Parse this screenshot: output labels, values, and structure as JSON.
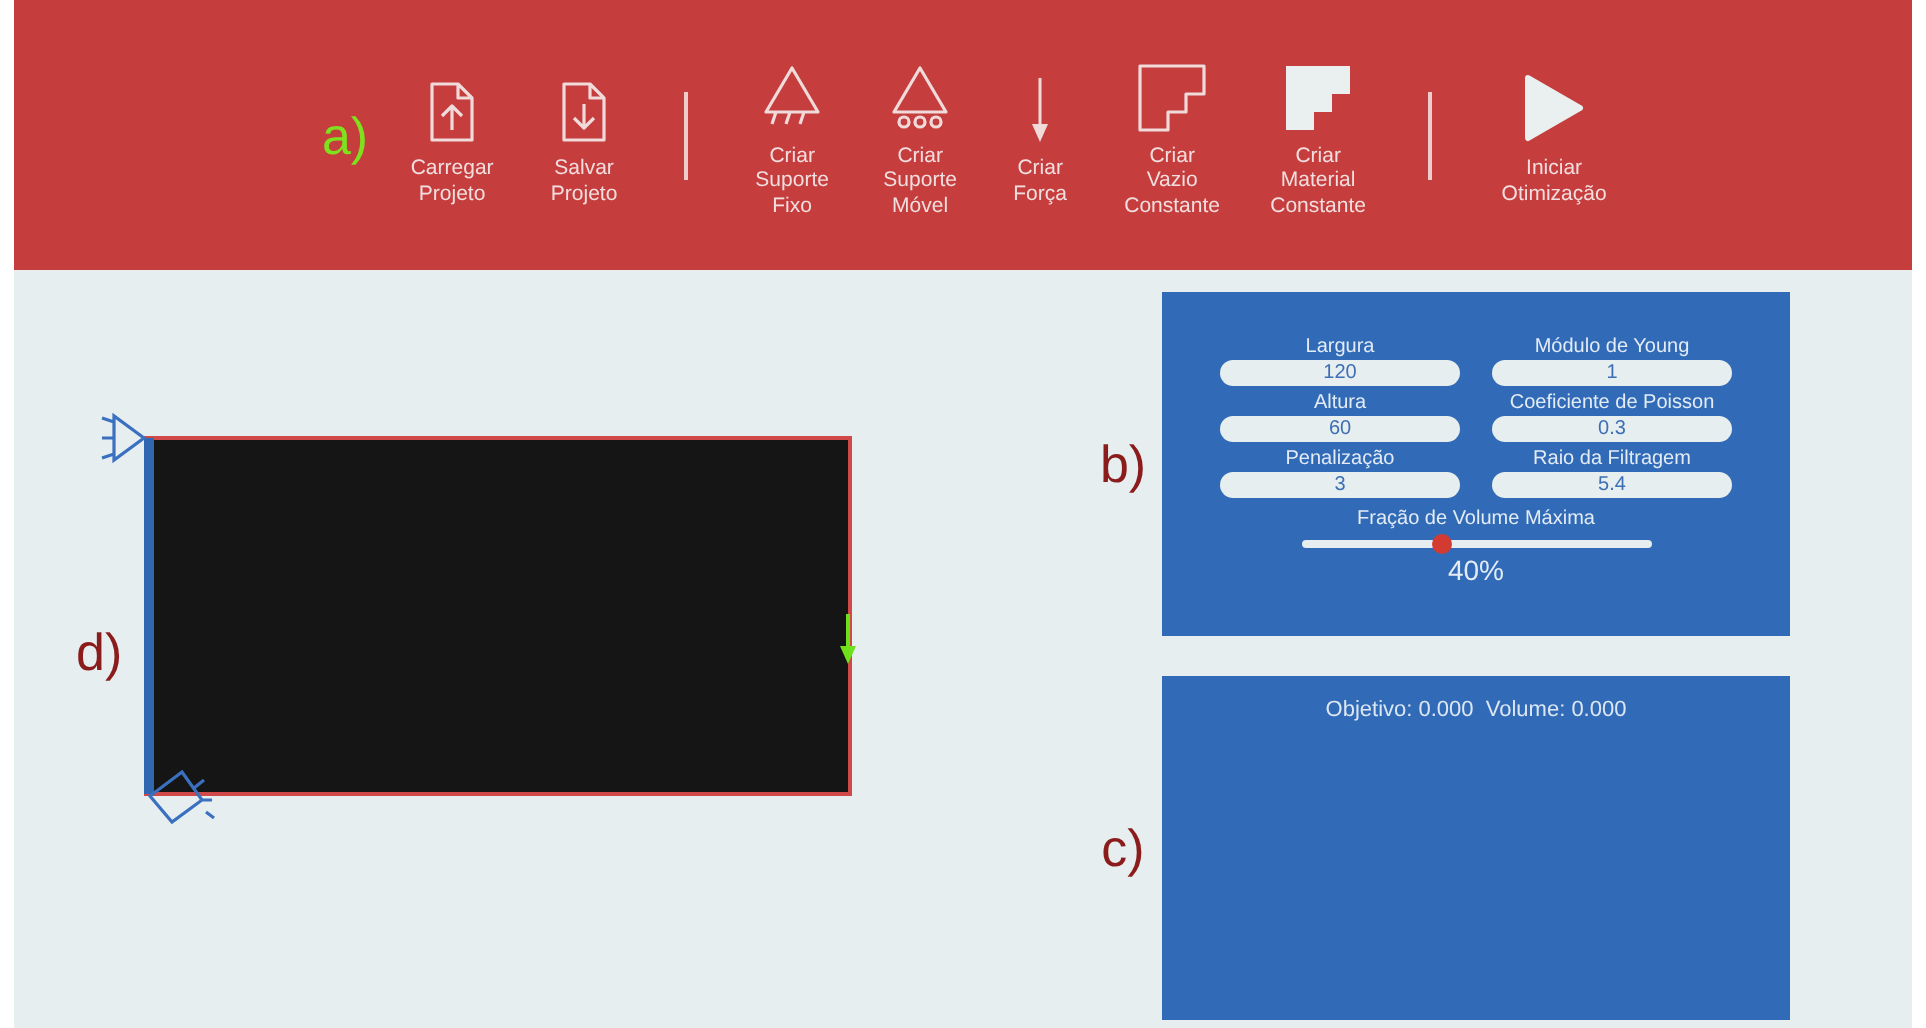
{
  "toolbar": {
    "section_label": "a)",
    "items": [
      {
        "kind": "load",
        "label": "Carregar\nProjeto"
      },
      {
        "kind": "save",
        "label": "Salvar\nProjeto"
      },
      {
        "kind": "separator"
      },
      {
        "kind": "fixed",
        "label": "Criar\nSuporte\nFixo"
      },
      {
        "kind": "roller",
        "label": "Criar\nSuporte\nMóvel"
      },
      {
        "kind": "force",
        "label": "Criar\nForça"
      },
      {
        "kind": "void",
        "label": "Criar\nVazio\nConstante"
      },
      {
        "kind": "material",
        "label": "Criar\nMaterial\nConstante"
      },
      {
        "kind": "separator"
      },
      {
        "kind": "play",
        "label": "Iniciar\nOtimização"
      }
    ]
  },
  "canvas": {
    "section_label": "d)"
  },
  "parameters": {
    "section_label": "b)",
    "fields": [
      {
        "label": "Largura",
        "value": "120"
      },
      {
        "label": "Módulo de Young",
        "value": "1"
      },
      {
        "label": "Altura",
        "value": "60"
      },
      {
        "label": "Coeficiente de Poisson",
        "value": "0.3"
      },
      {
        "label": "Penalização",
        "value": "3"
      },
      {
        "label": "Raio da Filtragem",
        "value": "5.4"
      }
    ],
    "volume": {
      "label": "Fração de Volume Máxima",
      "level": 0.4,
      "reading": "40%"
    }
  },
  "results": {
    "section_label": "c)",
    "text": "Objetivo: 0.000  Volume: 0.000"
  }
}
